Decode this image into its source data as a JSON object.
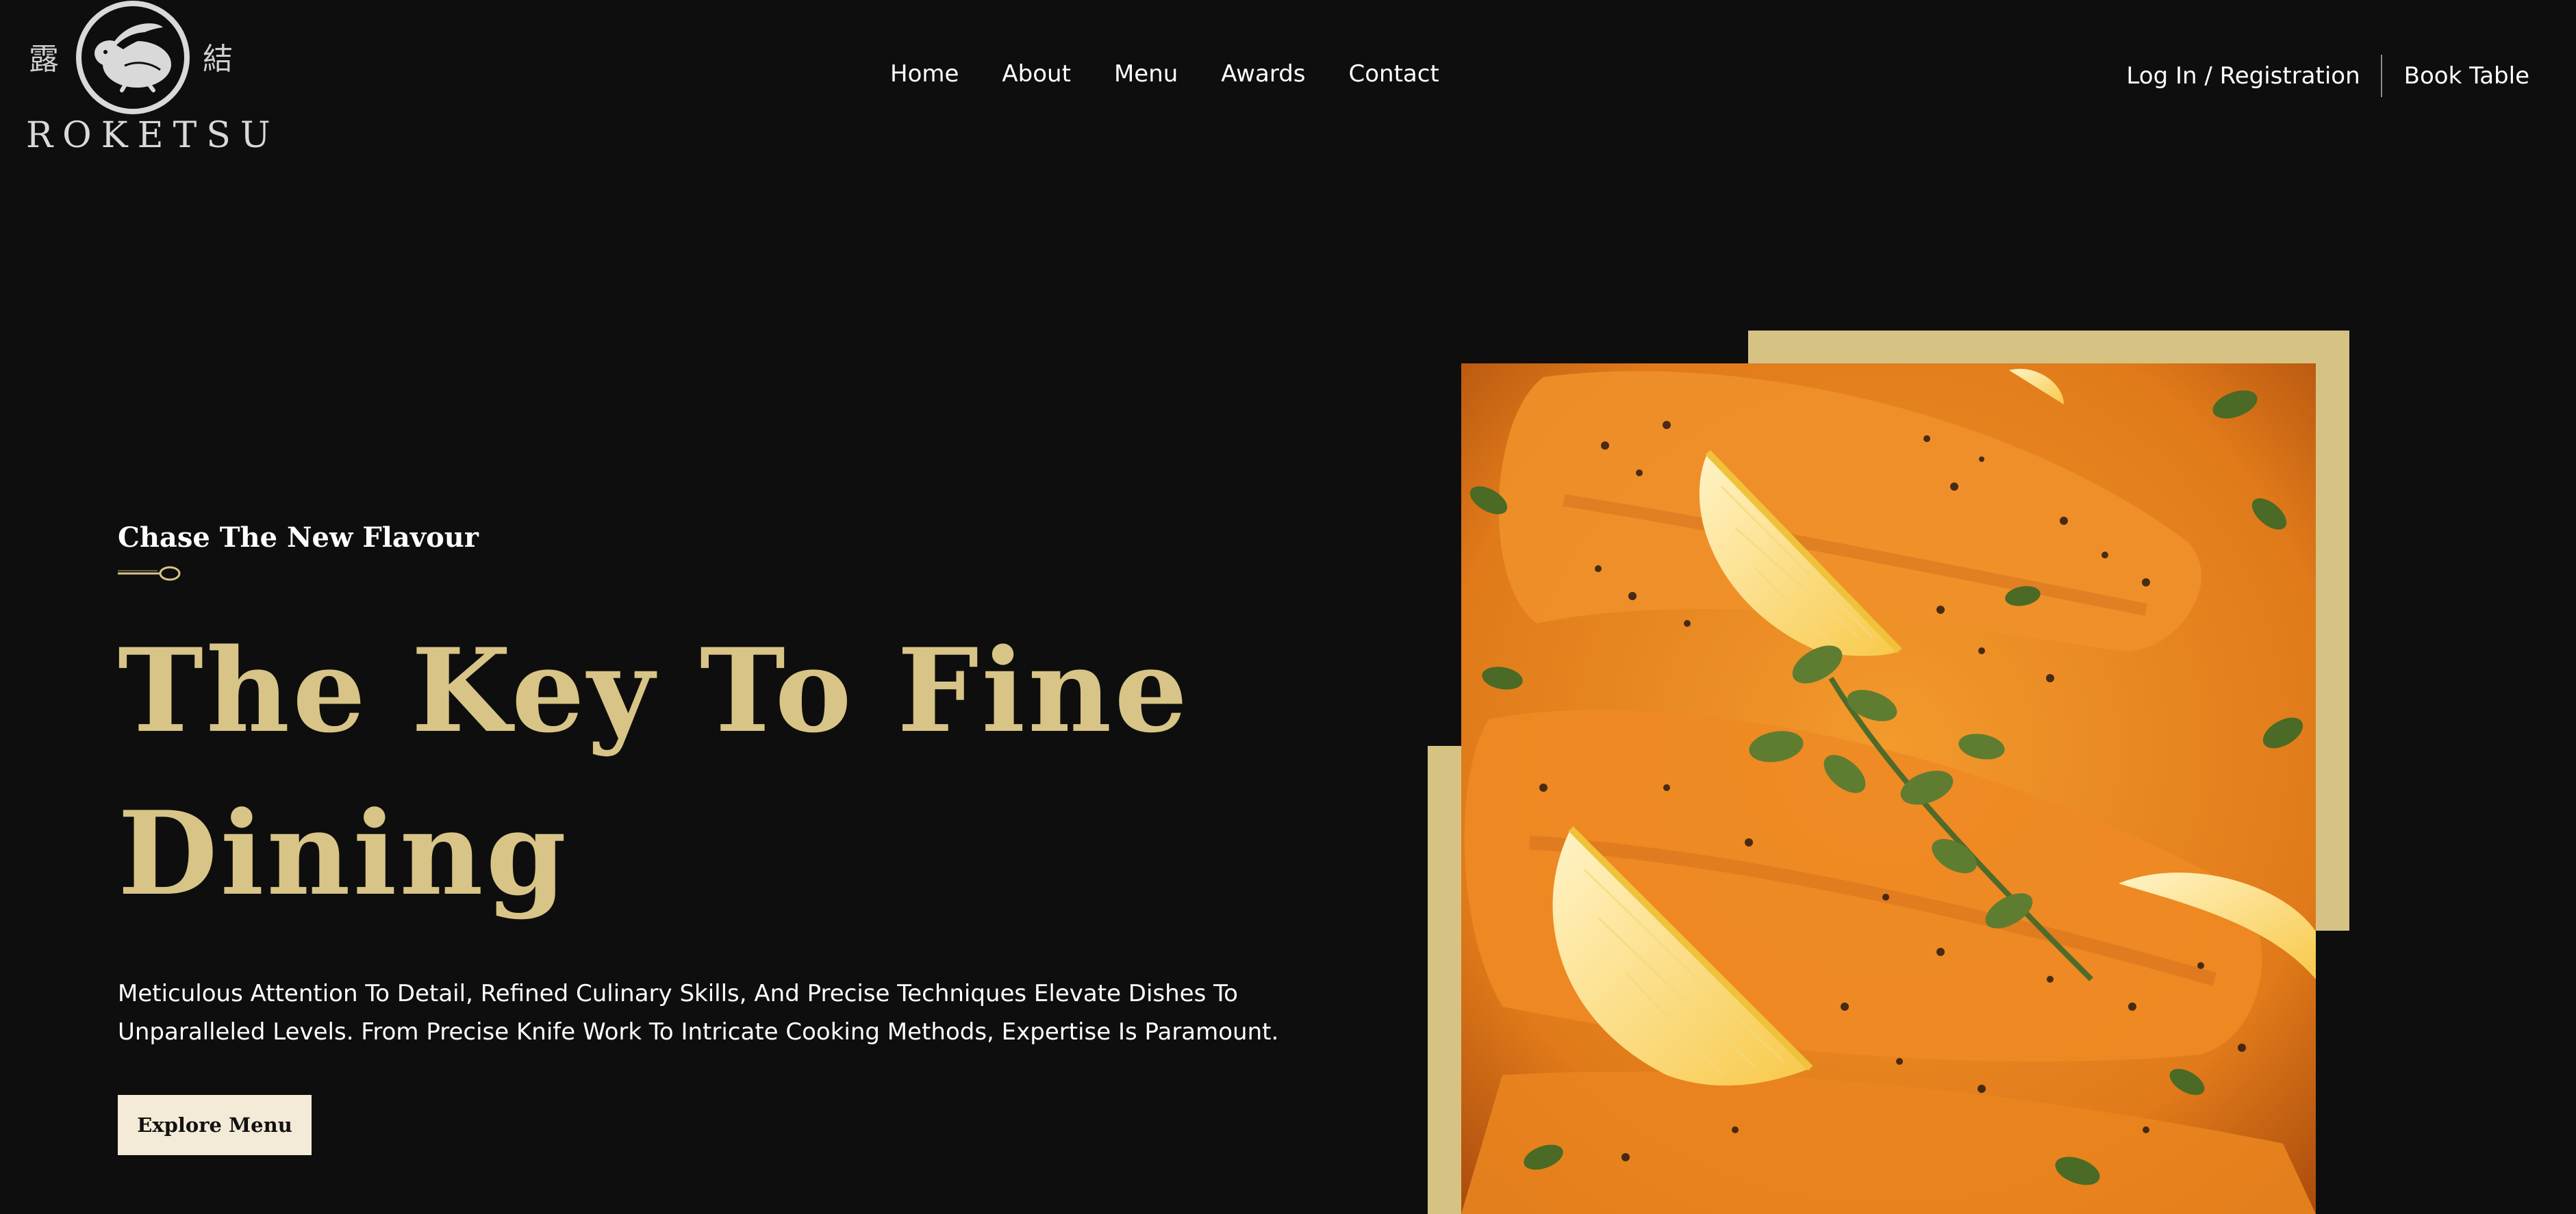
{
  "brand": {
    "name": "ROKETSU",
    "kanji_left": "露",
    "kanji_right": "結"
  },
  "nav": {
    "items": [
      "Home",
      "About",
      "Menu",
      "Awards",
      "Contact"
    ]
  },
  "header_actions": {
    "login": "Log In / Registration",
    "book": "Book Table"
  },
  "hero": {
    "eyebrow": "Chase The New Flavour",
    "title": "The Key To Fine Dining",
    "description": "Meticulous Attention To Detail, Refined Culinary Skills, And Precise Techniques Elevate Dishes To Unparalleled Levels. From Precise Knife Work To Intricate Cooking Methods, Expertise Is Paramount.",
    "cta": "Explore Menu"
  },
  "colors": {
    "background": "#0e0e0e",
    "accent_gold": "#d8c486",
    "frame_gold": "#d6c383",
    "button_bg": "#f3ead7"
  },
  "icons": {
    "logo": "rabbit-emblem-icon",
    "divider": "spoon-icon"
  }
}
